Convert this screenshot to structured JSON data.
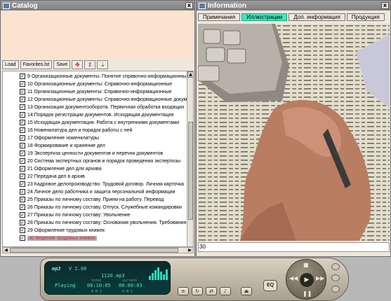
{
  "catalog": {
    "title": "Catalog",
    "close": "x",
    "toolbar": {
      "load": "Load",
      "favorites": "Favorites.lst",
      "save": "Save"
    },
    "items": [
      {
        "label": "9 Организационные документы: Понятие справочно-информационных",
        "checked": true
      },
      {
        "label": "10 Организационные документы: Справочно-информационные",
        "checked": true
      },
      {
        "label": "11 Организационные документы: Справочно-информационные",
        "checked": true
      },
      {
        "label": "12 Организационные документы: Справочно-информационные докум",
        "checked": true
      },
      {
        "label": "13 Организация документооборота. Первичная обработка входящих",
        "checked": true
      },
      {
        "label": "14 Порядок регистрации документов. Исходящая документация",
        "checked": true
      },
      {
        "label": "15 Исходящая документация. Работа с внутренними документами",
        "checked": true
      },
      {
        "label": "16 Номенклатура дел и порядок работы с ней",
        "checked": true
      },
      {
        "label": "17 Оформление номенклатуры",
        "checked": true
      },
      {
        "label": "18 Формирование и хранение дел",
        "checked": true
      },
      {
        "label": "19 Экспертиза ценности документов и перечни документов",
        "checked": true
      },
      {
        "label": "20 Система экспертных органов и порядок проведения экспертизы",
        "checked": true
      },
      {
        "label": "21 Оформление дел для архива",
        "checked": true
      },
      {
        "label": "22 Передача дел в архив",
        "checked": true
      },
      {
        "label": "23 Кадровое делопроизводство. Трудовой договор. Личная карточка",
        "checked": true
      },
      {
        "label": "24 Личное дело работника и защита персональной информации",
        "checked": true
      },
      {
        "label": "25 Приказы по личному составу. Прием на работу. Перевод",
        "checked": true
      },
      {
        "label": "26 Приказы по личному составу. Отпуск. Служебные командировки",
        "checked": true
      },
      {
        "label": "27 Приказы по личному составу: Увольнение",
        "checked": true
      },
      {
        "label": "28 Приказы по личному составу: Основания увольнения. Требования",
        "checked": true
      },
      {
        "label": "29 Оформление трудовых книжек",
        "checked": true
      },
      {
        "label": "30 Ведение трудовых книжек",
        "checked": true,
        "selected": true
      }
    ]
  },
  "info": {
    "title": "Information",
    "close": "x",
    "tabs": [
      {
        "label": "Примечания",
        "active": false
      },
      {
        "label": "Иллюстрации",
        "active": true
      },
      {
        "label": "Доп. информация",
        "active": false
      },
      {
        "label": "Продукция",
        "active": false
      }
    ],
    "status": "30"
  },
  "player": {
    "logo": "mp3",
    "version": "V 2.00",
    "track": "1120.mp3",
    "state": "Playing",
    "total_label": "total",
    "current_label": "current",
    "total_time": "00:10:05",
    "current_time": "00:00:03",
    "hms": "H M S",
    "eq_label": "EQ"
  }
}
